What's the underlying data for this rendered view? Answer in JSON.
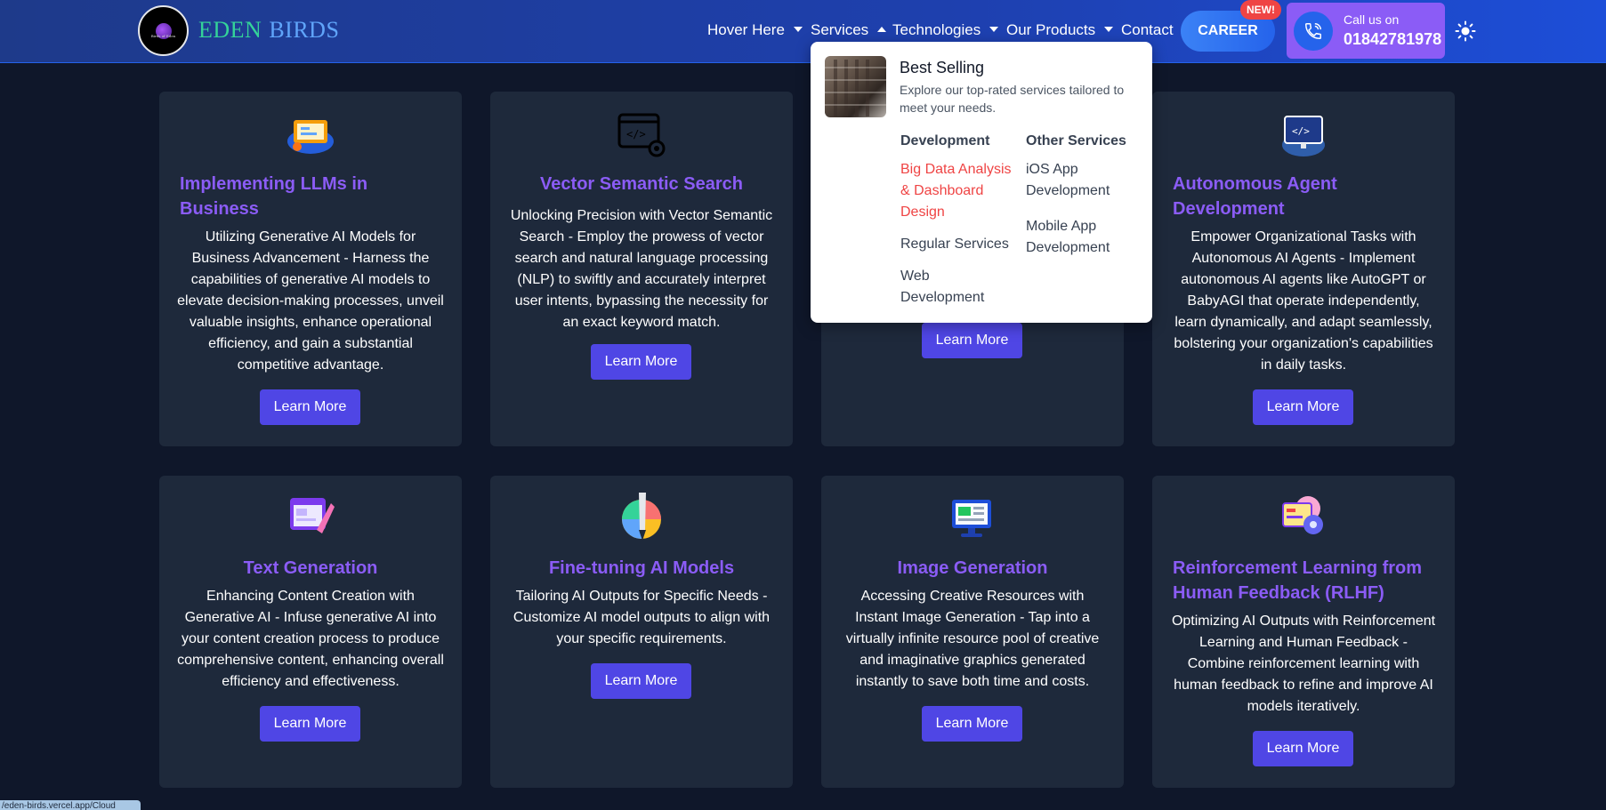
{
  "brand": {
    "part1": "EDEN",
    "part2": "BIRDS",
    "logo_text": "Birds of Eden"
  },
  "nav": {
    "hover_here": "Hover Here",
    "services": "Services",
    "technologies": "Technologies",
    "our_products": "Our Products",
    "contact": "Contact"
  },
  "career": {
    "label": "CAREER",
    "badge": "NEW!"
  },
  "call": {
    "label": "Call us on",
    "number": "01842781978"
  },
  "dropdown": {
    "title": "Best Selling",
    "subtitle": "Explore our top-rated services tailored to meet your needs.",
    "col1": {
      "heading": "Development",
      "links": [
        "Big Data Analysis & Dashboard Design",
        "Regular Services",
        "Web Development"
      ]
    },
    "col2": {
      "heading": "Other Services",
      "links": [
        "iOS App Development",
        "Mobile App Development"
      ]
    }
  },
  "cards": [
    {
      "title": "Implementing LLMs in Business",
      "desc": "Utilizing Generative AI Models for Business Advancement - Harness the capabilities of generative AI models to elevate decision-making processes, unveil valuable insights, enhance operational efficiency, and gain a substantial competitive advantage.",
      "button": "Learn More"
    },
    {
      "title": "Vector Semantic Search",
      "desc": "Unlocking Precision with Vector Semantic Search - Employ the prowess of vector search and natural language processing (NLP) to swiftly and accurately interpret user intents, bypassing the necessity for an exact keyword match.",
      "button": "Learn More"
    },
    {
      "title": "",
      "desc": "",
      "button": "Learn More"
    },
    {
      "title": "Autonomous Agent Development",
      "desc": "Empower Organizational Tasks with Autonomous AI Agents - Implement autonomous AI agents like AutoGPT or BabyAGI that operate independently, learn dynamically, and adapt seamlessly, bolstering your organization's capabilities in daily tasks.",
      "button": "Learn More"
    },
    {
      "title": "Text Generation",
      "desc": "Enhancing Content Creation with Generative AI - Infuse generative AI into your content creation process to produce comprehensive content, enhancing overall efficiency and effectiveness.",
      "button": "Learn More"
    },
    {
      "title": "Fine-tuning AI Models",
      "desc": "Tailoring AI Outputs for Specific Needs - Customize AI model outputs to align with your specific requirements.",
      "button": "Learn More"
    },
    {
      "title": "Image Generation",
      "desc": "Accessing Creative Resources with Instant Image Generation - Tap into a virtually infinite resource pool of creative and imaginative graphics generated instantly to save both time and costs.",
      "button": "Learn More"
    },
    {
      "title": "Reinforcement Learning from Human Feedback (RLHF)",
      "desc": "Optimizing AI Outputs with Reinforcement Learning and Human Feedback - Combine reinforcement learning with human feedback to refine and improve AI models iteratively.",
      "button": "Learn More"
    }
  ],
  "statusbar": {
    "text": "/eden-birds.vercel.app/Cloud"
  },
  "colors": {
    "accent": "#4f46e5",
    "title": "#8b5cf6",
    "card_bg": "#1e293b",
    "page_bg": "#0f172a",
    "header": "#1e40af",
    "active_link": "#ef4444"
  },
  "icons": {
    "card0": "presentation-board-icon",
    "card1": "code-window-gear-icon",
    "card3": "code-monitor-icon",
    "card4": "design-window-pen-icon",
    "card5": "paint-brush-palette-icon",
    "card6": "image-monitor-icon",
    "card7": "robot-feedback-icon"
  }
}
